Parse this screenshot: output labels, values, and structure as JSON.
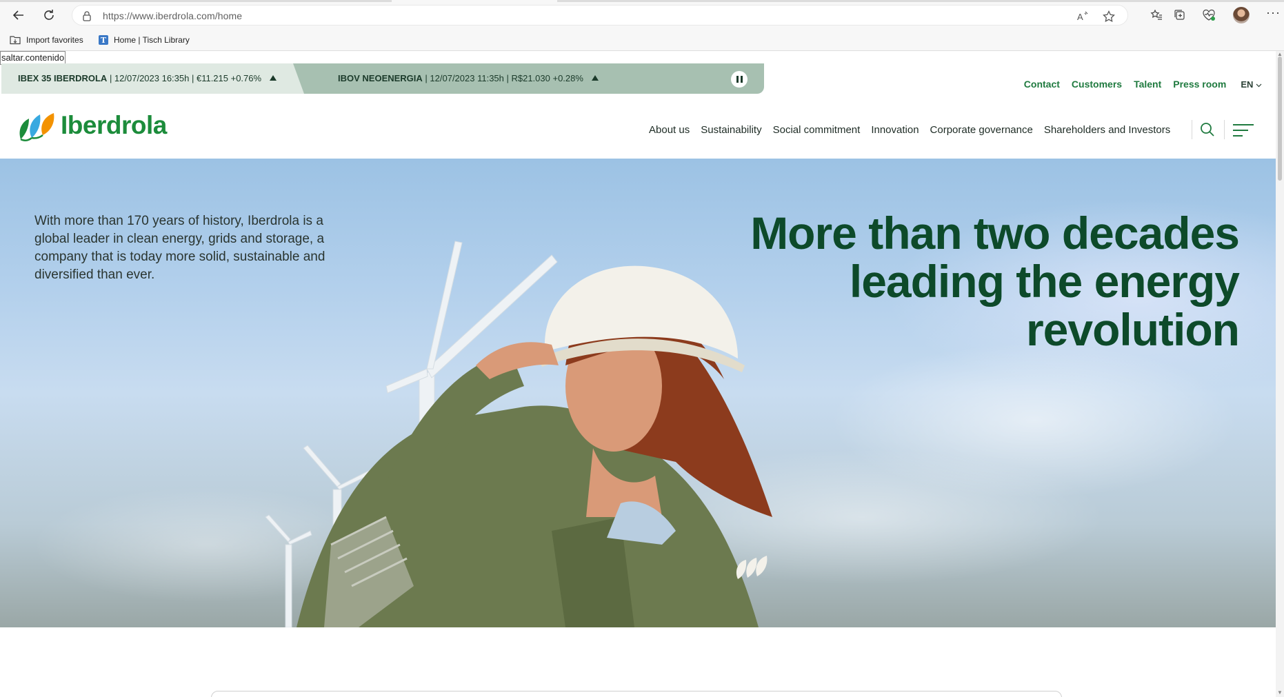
{
  "browser": {
    "url_full": "https://www.iberdrola.com/home",
    "bookmarks": [
      {
        "label": "Import favorites",
        "icon": "import-favorites-icon"
      },
      {
        "label": "Home | Tisch Library",
        "icon": "tisch-library-icon",
        "icon_letter": "T"
      }
    ]
  },
  "page": {
    "skip_link": "saltar.contenido",
    "ticker": {
      "items": [
        {
          "name": "IBEX 35 IBERDROLA",
          "details": "| 12/07/2023 16:35h | €11.215 +0.76%",
          "trend": "up"
        },
        {
          "name": "IBOV NEOENERGIA",
          "details": "| 12/07/2023 11:35h | R$21.030 +0.28%",
          "trend": "up"
        }
      ]
    },
    "utility_nav": [
      "Contact",
      "Customers",
      "Talent",
      "Press room"
    ],
    "language": "EN",
    "logo": "Iberdrola",
    "main_nav": [
      "About us",
      "Sustainability",
      "Social commitment",
      "Innovation",
      "Corporate governance",
      "Shareholders and Investors"
    ],
    "hero": {
      "intro": "With more than 170 years of history, Iberdrola is a global leader in clean energy, grids and storage, a company that is today more solid, sustainable and diversified than ever.",
      "title": "More than two decades leading the energy revolution"
    }
  },
  "colors": {
    "brand_green": "#1c8c3b",
    "brand_dark_green": "#0d4a2a",
    "logo_orange": "#f39200",
    "logo_blue": "#38a9e0",
    "ticker_left": "#dfe9e2",
    "ticker_right": "#a7c0b1"
  }
}
